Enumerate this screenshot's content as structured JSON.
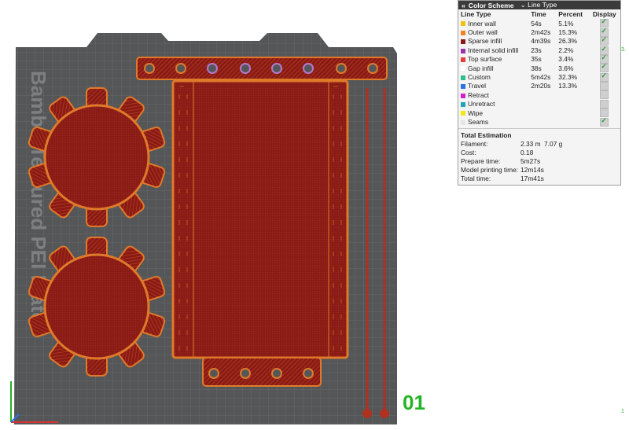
{
  "legend": {
    "title": "Color Scheme",
    "mode": "Line Type",
    "columns": [
      "Line Type",
      "Time",
      "Percent",
      "Display"
    ],
    "rows": [
      {
        "name": "Inner wall",
        "time": "54s",
        "percent": "5.1%",
        "color": "#f0c30a",
        "on": true
      },
      {
        "name": "Outer wall",
        "time": "2m42s",
        "percent": "15.3%",
        "color": "#f5821f",
        "on": true
      },
      {
        "name": "Sparse infill",
        "time": "4m39s",
        "percent": "26.3%",
        "color": "#8b1a16",
        "on": true
      },
      {
        "name": "Internal solid infill",
        "time": "23s",
        "percent": "2.2%",
        "color": "#9a2fb0",
        "on": true
      },
      {
        "name": "Top surface",
        "time": "35s",
        "percent": "3.4%",
        "color": "#e83d3d",
        "on": true
      },
      {
        "name": "Gap infill",
        "time": "38s",
        "percent": "3.6%",
        "color": "#ffffff",
        "on": true
      },
      {
        "name": "Custom",
        "time": "5m42s",
        "percent": "32.3%",
        "color": "#2bbd8d",
        "on": true
      },
      {
        "name": "Travel",
        "time": "2m20s",
        "percent": "13.3%",
        "color": "#2f6fe6",
        "on": false
      },
      {
        "name": "Retract",
        "time": "",
        "percent": "",
        "color": "#d21fd0",
        "on": false
      },
      {
        "name": "Unretract",
        "time": "",
        "percent": "",
        "color": "#22a3b3",
        "on": false
      },
      {
        "name": "Wipe",
        "time": "",
        "percent": "",
        "color": "#f5e80c",
        "on": false
      },
      {
        "name": "Seams",
        "time": "",
        "percent": "",
        "color": "#e6e6e6",
        "on": true
      }
    ],
    "estimation_title": "Total Estimation",
    "estimation": [
      {
        "label": "Filament:",
        "value": "2.33 m",
        "extra": "7.07 g"
      },
      {
        "label": "Cost:",
        "value": "0.18",
        "extra": ""
      },
      {
        "label": "Prepare time:",
        "value": "5m27s",
        "extra": ""
      },
      {
        "label": "Model printing time:",
        "value": "12m14s",
        "extra": ""
      },
      {
        "label": "Total time:",
        "value": "17m41s",
        "extra": ""
      }
    ]
  },
  "plate": {
    "label": "Bambu Textured PEI Plate",
    "layer_number": "01",
    "edge_markers": [
      "3.",
      "1"
    ]
  },
  "colors": {
    "plate_bg": "#545657",
    "grid": "#6a6c6d",
    "infill": "#8b1a16",
    "wall": "#e07a2b",
    "accent": "#23b323"
  }
}
